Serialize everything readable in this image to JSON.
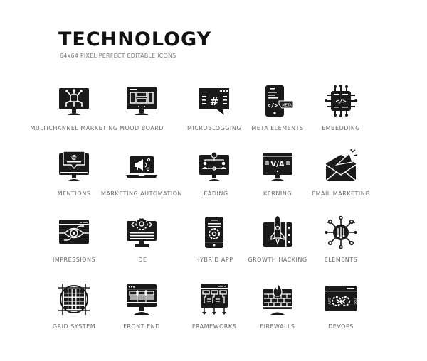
{
  "header": {
    "title": "TECHNOLOGY",
    "subtitle": "64x64 PIXEL PERFECT EDITABLE ICONS"
  },
  "colors": {
    "icon": "#1a1a1a",
    "label": "#6b6b6b",
    "background": "#ffffff"
  },
  "icons": [
    {
      "label": "MULTICHANNEL MARKETING",
      "icon": "monitor-network-icon"
    },
    {
      "label": "MOOD BOARD",
      "icon": "monitor-layout-icon"
    },
    {
      "label": "MICROBLOGGING",
      "icon": "chat-hashtag-icon"
    },
    {
      "label": "META ELEMENTS",
      "icon": "tablet-meta-code-icon"
    },
    {
      "label": "EMBEDDING",
      "icon": "chip-code-icon"
    },
    {
      "label": "MENTIONS",
      "icon": "monitor-at-sign-icon"
    },
    {
      "label": "MARKETING AUTOMATION",
      "icon": "laptop-megaphone-icon"
    },
    {
      "label": "LEADING",
      "icon": "monitor-hierarchy-icon"
    },
    {
      "label": "KERNING",
      "icon": "monitor-kerning-icon"
    },
    {
      "label": "EMAIL MARKETING",
      "icon": "envelope-megaphone-icon"
    },
    {
      "label": "IMPRESSIONS",
      "icon": "browser-eye-icon"
    },
    {
      "label": "IDE",
      "icon": "monitor-gear-code-icon"
    },
    {
      "label": "HYBRID APP",
      "icon": "phone-gear-icon"
    },
    {
      "label": "GROWTH HACKING",
      "icon": "rocket-panel-icon"
    },
    {
      "label": "ELEMENTS",
      "icon": "atom-network-icon"
    },
    {
      "label": "GRID SYSTEM",
      "icon": "circle-grid-icon"
    },
    {
      "label": "FRONT END",
      "icon": "monitor-frontend-icon"
    },
    {
      "label": "FRAMEWORKS",
      "icon": "browser-flowchart-icon"
    },
    {
      "label": "FIREWALLS",
      "icon": "monitor-firewall-icon"
    },
    {
      "label": "DEVOPS",
      "icon": "browser-devops-icon"
    }
  ]
}
